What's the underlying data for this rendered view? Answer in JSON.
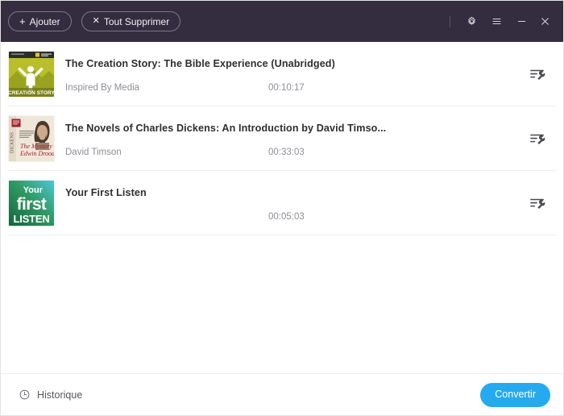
{
  "titlebar": {
    "add_label": "Ajouter",
    "add_icon": "plus-icon",
    "clear_all_label": "Tout Supprimer",
    "clear_all_icon": "close-x-icon",
    "settings_icon": "gear-icon",
    "menu_icon": "hamburger-menu-icon",
    "minimize_icon": "minimize-icon",
    "close_icon": "close-icon",
    "background_color": "#332D3F"
  },
  "list": {
    "action_icon": "edit-settings-wrench-icon",
    "items": [
      {
        "title": "The Creation Story: The Bible Experience (Unabridged)",
        "author": "Inspired By Media",
        "duration": "00:10:17",
        "cover": "creation-story-cover"
      },
      {
        "title": "The Novels of Charles Dickens: An Introduction by David Timso...",
        "author": "David Timson",
        "duration": "00:33:03",
        "cover": "charles-dickens-cover"
      },
      {
        "title": "Your First Listen",
        "author": "",
        "duration": "00:05:03",
        "cover": "your-first-listen-cover"
      }
    ]
  },
  "footer": {
    "history_label": "Historique",
    "history_icon": "clock-icon",
    "convert_label": "Convertir",
    "convert_color": "#25AAF0"
  }
}
